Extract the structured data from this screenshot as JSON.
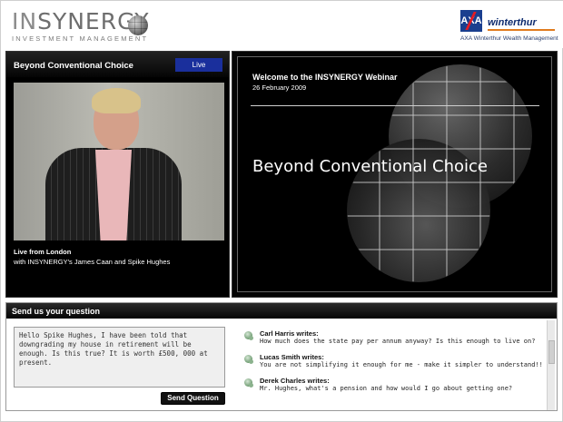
{
  "header": {
    "brand_in": "IN",
    "brand_rest": "SYNERGY",
    "brand_sub": "INVESTMENT MANAGEMENT",
    "partner_box": "AXA",
    "partner_name": "winterthur",
    "partner_tag": "AXA Winterthur Wealth Management"
  },
  "video": {
    "title": "Beyond Conventional Choice",
    "live_label": "Live",
    "location": "Live from London",
    "presenters": "with INSYNERGY's James Caan and Spike Hughes"
  },
  "slide": {
    "heading": "Welcome to the INSYNERGY Webinar",
    "date": "26 February 2009",
    "headline": "Beyond Conventional Choice"
  },
  "question": {
    "title": "Send us your question",
    "input_value": "Hello Spike Hughes, I have been told that downgrading my house in retirement will be enough. Is this true? It is worth £500, 000 at present.",
    "send_label": "Send Question"
  },
  "messages": [
    {
      "author": "Carl Harris writes:",
      "text": "How much does the state pay per annum anyway? Is this enough to live on?"
    },
    {
      "author": "Lucas Smith writes:",
      "text": "You are not simplifying it enough for me - make it simpler to understand!!"
    },
    {
      "author": "Derek Charles writes:",
      "text": "Mr. Hughes, what's a pension and how would I go about getting one?"
    }
  ],
  "colors": {
    "live_badge": "#1a2f9c",
    "axa_blue": "#1a3f8f",
    "axa_red": "#e31b23",
    "partner_orange": "#e07b1e"
  }
}
